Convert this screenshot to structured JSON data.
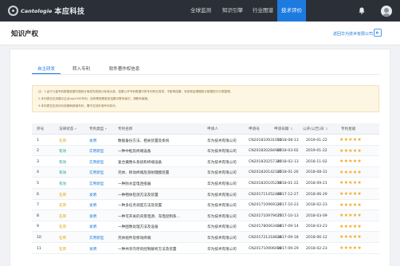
{
  "nav": {
    "logo_en": "Cantologie",
    "logo_cn": "本应科技",
    "items": [
      {
        "label": "全球监测",
        "active": false
      },
      {
        "label": "知识引擎",
        "active": false
      },
      {
        "label": "行业图谱",
        "active": false
      },
      {
        "label": "技术评价",
        "active": true
      }
    ]
  },
  "page": {
    "title": "知识产权",
    "back_link": "返回华为技术有限公司"
  },
  "tabs": [
    {
      "label": "自主研发",
      "active": true
    },
    {
      "label": "转入专利",
      "active": false
    },
    {
      "label": "软件著作权信息",
      "active": false
    }
  ],
  "notice": {
    "lines": [
      "注：1.由于计量专利数据依据中国统计局发布的统计标准为准，如果公开专利数据中的专利有无效或，不影响结果。系统将会根据统计数据进行分类整理。",
      "2.本列表仅支持展示企业top1000专利，如有需查看更多结果可联系我们，请联系客服。",
      "3.本列表仅支持评价前期和新增专利，需不支持外观专利评价。"
    ]
  },
  "table": {
    "headers": [
      "序号",
      "法律状态",
      "专利类型",
      "专利名称",
      "申请人",
      "申请号",
      "申请日期",
      "公开(公告)日",
      "专利星级"
    ],
    "rows": [
      {
        "no": "1",
        "status": "在审",
        "type": "发明",
        "name": "数据备份方法、相关装置及系统",
        "applicant": "华为技术有限公司",
        "appno": "CN201810931053",
        "appdate": "2018-08-13",
        "pubdate": "2019-01-22",
        "stars": "★★★★★"
      },
      {
        "no": "2",
        "status": "有效",
        "type": "实用新型",
        "name": "一种中框及终端设备",
        "applicant": "华为技术有限公司",
        "appno": "CN201820284985",
        "appdate": "2018-03-02",
        "pubdate": "2019-01-22",
        "stars": "★★★★★"
      },
      {
        "no": "3",
        "status": "有效",
        "type": "实用新型",
        "name": "复合摄像头系统和终端设备",
        "applicant": "华为技术有限公司",
        "appno": "CN201820257340",
        "appdate": "2018-02-13",
        "pubdate": "2018-11-02",
        "stars": "★★★★★"
      },
      {
        "no": "4",
        "status": "有效",
        "type": "实用新型",
        "name": "壳体、移动终端及测射键膜装置",
        "applicant": "华为技术有限公司",
        "appno": "CN201820142185",
        "appdate": "2018-01-26",
        "pubdate": "2018-08-31",
        "stars": "★★★★★"
      },
      {
        "no": "5",
        "status": "有效",
        "type": "实用新型",
        "name": "一种防水型电连接器",
        "applicant": "华为技术有限公司",
        "appno": "CN201820105258",
        "appdate": "2018-01-22",
        "pubdate": "2018-09-21",
        "stars": "★★★★★"
      },
      {
        "no": "6",
        "status": "在审",
        "type": "发明",
        "name": "一种物体检测方法及装置",
        "applicant": "华为技术有限公司",
        "appno": "CN201711452468",
        "appdate": "2017-12-27",
        "pubdate": "2018-06-29",
        "stars": "★★★★★"
      },
      {
        "no": "7",
        "status": "在审",
        "type": "发明",
        "name": "一种多任务调度方法及装置",
        "applicant": "华为技术有限公司",
        "appno": "CN201710969326",
        "appdate": "2017-10-23",
        "pubdate": "2018-02-23",
        "stars": "★★★★★"
      },
      {
        "no": "8",
        "status": "在审",
        "type": "发明",
        "name": "一种可开关的背景电源、充电控制系…",
        "applicant": "华为技术有限公司",
        "appno": "CN201710979677",
        "appdate": "2017-10-13",
        "pubdate": "2018-03-09",
        "stars": "★★★★★"
      },
      {
        "no": "9",
        "status": "在审",
        "type": "发明",
        "name": "一种图像处理方法及设备",
        "applicant": "华为技术有限公司",
        "appno": "CN201780063404",
        "appdate": "2017-09-14",
        "pubdate": "2018-03-23",
        "stars": "★★★★★"
      },
      {
        "no": "10",
        "status": "在审",
        "type": "实用新型",
        "name": "壳体组件及移动终端",
        "applicant": "华为技术有限公司",
        "appno": "CN201721318838",
        "appdate": "2017-09-18",
        "pubdate": "2018-06-12",
        "stars": "★★★★★"
      },
      {
        "no": "11",
        "status": "在审",
        "type": "发明",
        "name": "一种共享内存的控制解析方法及装置",
        "applicant": "华为技术有限公司",
        "appno": "CN201710906098",
        "appdate": "2017-09-29",
        "pubdate": "2018-02-23",
        "stars": "★★★★★"
      }
    ]
  }
}
